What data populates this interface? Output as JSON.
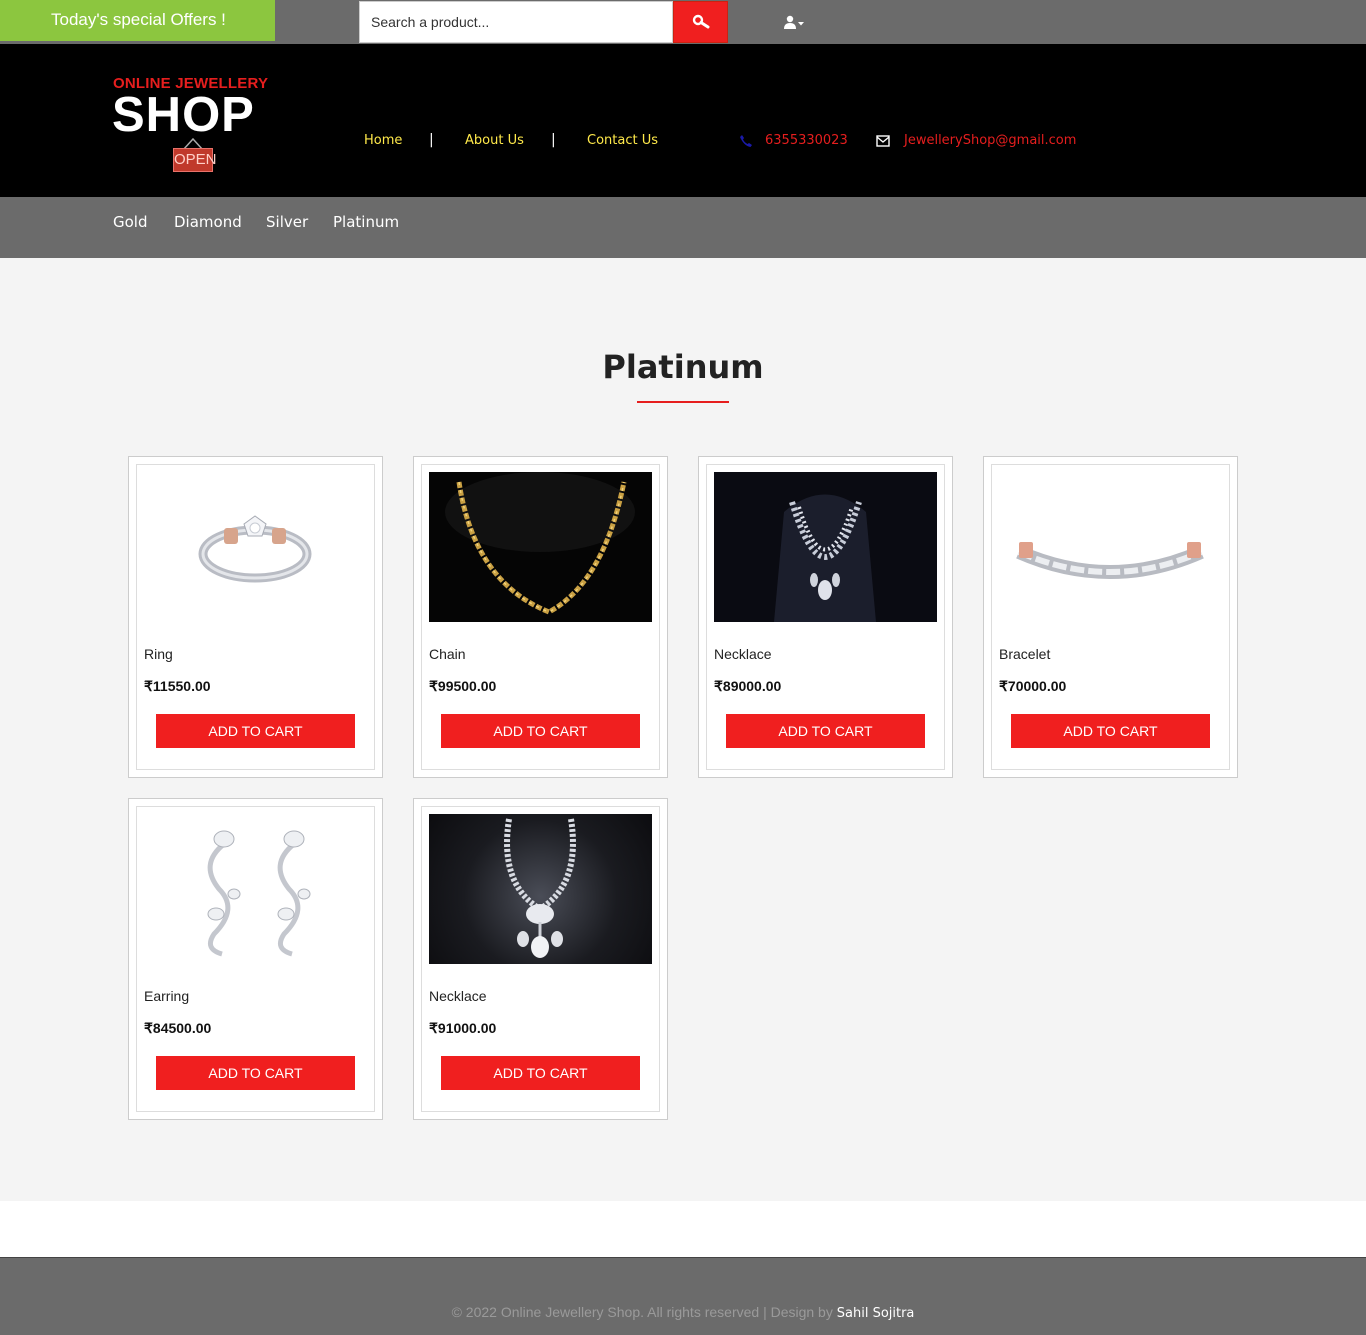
{
  "topbar": {
    "offers_label": "Today's special Offers !",
    "search_placeholder": "Search a product...",
    "search_icon": "search-icon",
    "user_icon": "user-dropdown-icon"
  },
  "header": {
    "logo_top": "ONLINE JEWELLERY",
    "logo_main": "SHOP",
    "logo_sign": "OPEN",
    "nav": [
      "Home",
      "About Us",
      "Contact Us"
    ],
    "nav_separator": "|",
    "phone": "6355330023",
    "email": "JewelleryShop@gmail.com"
  },
  "categories": [
    "Gold",
    "Diamond",
    "Silver",
    "Platinum"
  ],
  "main": {
    "title": "Platinum",
    "products": [
      {
        "name": "Ring",
        "price": "₹11550.00",
        "button": "ADD TO CART",
        "image": "ring"
      },
      {
        "name": "Chain",
        "price": "₹99500.00",
        "button": "ADD TO CART",
        "image": "chain"
      },
      {
        "name": "Necklace",
        "price": "₹89000.00",
        "button": "ADD TO CART",
        "image": "necklace-dark"
      },
      {
        "name": "Bracelet",
        "price": "₹70000.00",
        "button": "ADD TO CART",
        "image": "bracelet"
      },
      {
        "name": "Earring",
        "price": "₹84500.00",
        "button": "ADD TO CART",
        "image": "earring"
      },
      {
        "name": "Necklace",
        "price": "₹91000.00",
        "button": "ADD TO CART",
        "image": "necklace-pendant"
      }
    ]
  },
  "footer": {
    "copyright": "© 2022 Online Jewellery Shop. All rights reserved | Design by ",
    "author": "Sahil Sojitra"
  },
  "colors": {
    "accent_red": "#f01f1f",
    "offers_green": "#8cc63f",
    "nav_yellow": "#ffe94a",
    "bar_gray": "#6b6b6b"
  }
}
